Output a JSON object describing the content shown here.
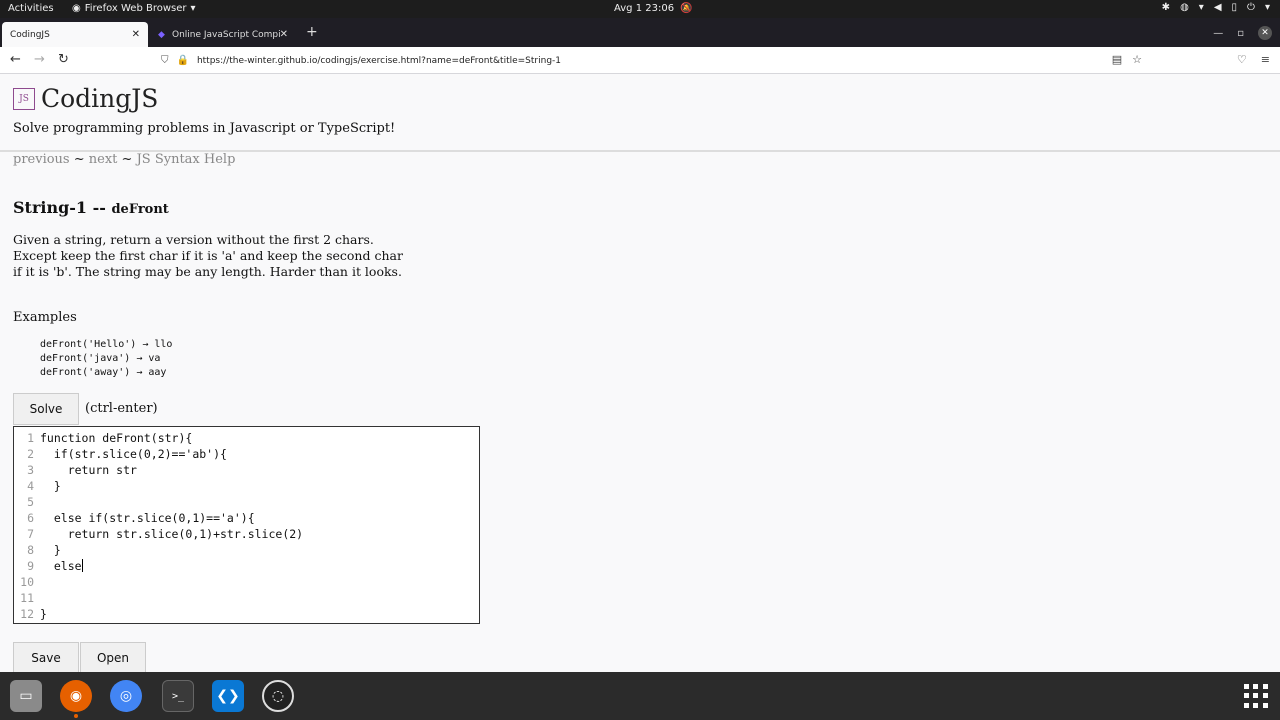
{
  "topbar": {
    "activities": "Activities",
    "app_name": "Firefox Web Browser",
    "clock": "Avg 1  23:06"
  },
  "tabs": [
    {
      "title": "CodingJS",
      "active": true
    },
    {
      "title": "Online JavaScript Compil",
      "active": false
    }
  ],
  "navbar": {
    "url": "https://the-winter.github.io/codingjs/exercise.html?name=deFront&title=String-1"
  },
  "page": {
    "site_title": "CodingJS",
    "logo_text": "JS",
    "tagline": "Solve programming problems in Javascript or TypeScript!",
    "nav": {
      "previous": "previous",
      "sep1": " ~ ",
      "next": "next",
      "sep2": " ~ ",
      "syntax_help": "JS Syntax Help"
    },
    "problem_title": "String-1 -- ",
    "problem_fn": "deFront",
    "description": "Given a string, return a version without the first 2 chars. Except keep the first char if it is 'a' and keep the second char if it is 'b'. The string may be any length. Harder than it looks.",
    "examples_label": "Examples",
    "examples": [
      "deFront('Hello') → llo",
      "deFront('java') → va",
      "deFront('away') → aay"
    ],
    "solve_label": "Solve",
    "hint": "(ctrl-enter)",
    "save_label": "Save",
    "open_label": "Open"
  },
  "editor": {
    "line_numbers": [
      "1",
      "2",
      "3",
      "4",
      "5",
      "6",
      "7",
      "8",
      "9",
      "10",
      "11",
      "12"
    ],
    "lines": [
      "function deFront(str){",
      "  if(str.slice(0,2)=='ab'){",
      "    return str",
      "  }",
      "",
      "  else if(str.slice(0,1)=='a'){",
      "    return str.slice(0,1)+str.slice(2)",
      "  }",
      "  else",
      "",
      "",
      "}"
    ]
  },
  "dock": {
    "terminal_label": ">_"
  }
}
